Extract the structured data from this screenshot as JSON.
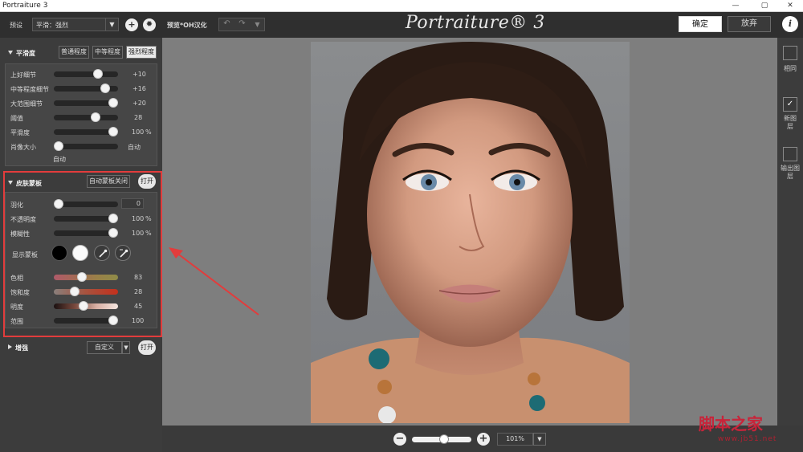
{
  "window": {
    "title": "Portraiture 3",
    "min": "—",
    "max": "▢",
    "close": "✕"
  },
  "topbar": {
    "preset_label": "预设",
    "preset_value": "平滑：强烈",
    "preview_label": "预览*OH汉化",
    "logo": "Portraiture® 3",
    "confirm": "确定",
    "discard": "放弃",
    "info": "i"
  },
  "smoothing": {
    "title": "平滑度",
    "modes": [
      "普通程度",
      "中等程度",
      "强烈程度"
    ],
    "active_mode": "强烈程度",
    "sliders": [
      {
        "label": "上好细节",
        "value": "+10",
        "pos": 0.72
      },
      {
        "label": "中等程度细节",
        "value": "+16",
        "pos": 0.85
      },
      {
        "label": "大范围细节",
        "value": "+20",
        "pos": 1.0
      },
      {
        "label": "阈值",
        "value": "28",
        "pos": 0.68
      },
      {
        "label": "平滑度",
        "value": "100",
        "unit": "%",
        "pos": 1.0
      },
      {
        "label": "肖像大小",
        "value": "自动",
        "pos": 0.0
      }
    ],
    "auto_text": "自动"
  },
  "skin_mask": {
    "title": "皮肤蒙板",
    "auto_mask_btn": "自动蒙板关闭",
    "open_btn": "打开",
    "feather": {
      "label": "羽化",
      "value": "0",
      "pos": 0.0
    },
    "opacity": {
      "label": "不透明度",
      "value": "100",
      "unit": "%",
      "pos": 1.0
    },
    "fuzziness": {
      "label": "模糊性",
      "value": "100",
      "unit": "%",
      "pos": 1.0
    },
    "show_mask_label": "显示蒙板",
    "hue": {
      "label": "色相",
      "value": "83",
      "pos": 0.42
    },
    "saturation": {
      "label": "饱和度",
      "value": "28",
      "pos": 0.3
    },
    "brightness": {
      "label": "明度",
      "value": "45",
      "pos": 0.45
    },
    "range": {
      "label": "范围",
      "value": "100",
      "pos": 1.0
    }
  },
  "enhance": {
    "title": "增强",
    "preset": "自定义",
    "open_btn": "打开"
  },
  "right": {
    "same_label": "相同",
    "new_layer_label": "新图层",
    "output_label": "输出图层"
  },
  "zoom": {
    "minus": "−",
    "plus": "+",
    "value": "101%",
    "pos": 0.55
  },
  "watermark": {
    "text": "脚本之家",
    "url": "www.jb51.net"
  },
  "colors": {
    "accent_red": "#e23c3c",
    "panel": "#3c3c3c",
    "canvas": "#7e7e7e"
  }
}
